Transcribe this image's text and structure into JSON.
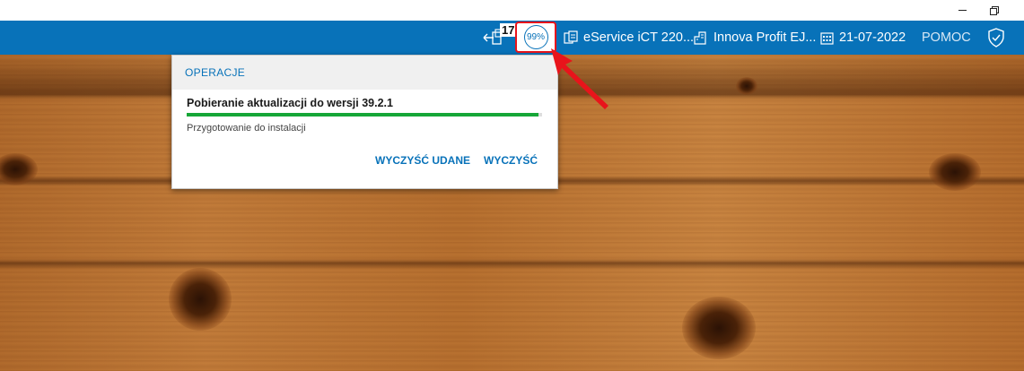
{
  "toolbar": {
    "notification_count": "17",
    "progress_percent": "99%",
    "progress_value": 99,
    "eservice_label": "eService iCT 220...",
    "company_label": "Innova Profit EJ...",
    "date": "21-07-2022",
    "help_label": "POMOC",
    "accent": "#0872b9"
  },
  "operations": {
    "header": "OPERACJE",
    "item_title": "Pobieranie aktualizacji do wersji 39.2.1",
    "item_progress": 0.99,
    "item_status": "Przygotowanie do instalacji",
    "clear_success_label": "WYCZYŚĆ UDANE",
    "clear_label": "WYCZYŚĆ",
    "progress_color": "#16a637"
  },
  "icons": {
    "logout": "logout-icon",
    "progress": "progress-circle-icon",
    "eservice": "device-icon",
    "company": "building-icon",
    "calendar": "calendar-icon",
    "shield": "shield-check-icon",
    "minimize": "minimize-icon",
    "restore": "restore-icon"
  }
}
